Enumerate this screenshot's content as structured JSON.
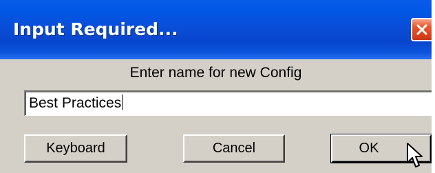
{
  "window": {
    "title": "Input Required..."
  },
  "dialog": {
    "prompt": "Enter name for new Config",
    "input_value": "Best Practices"
  },
  "buttons": {
    "keyboard_label": "Keyboard",
    "cancel_label": "Cancel",
    "ok_label": "OK"
  },
  "icons": {
    "close": "close-icon",
    "pointer": "mouse-pointer-icon"
  },
  "colors": {
    "titlebar": "#0a4ed8",
    "dialog_bg": "#d4d0c8",
    "close_button": "#d9431c"
  }
}
